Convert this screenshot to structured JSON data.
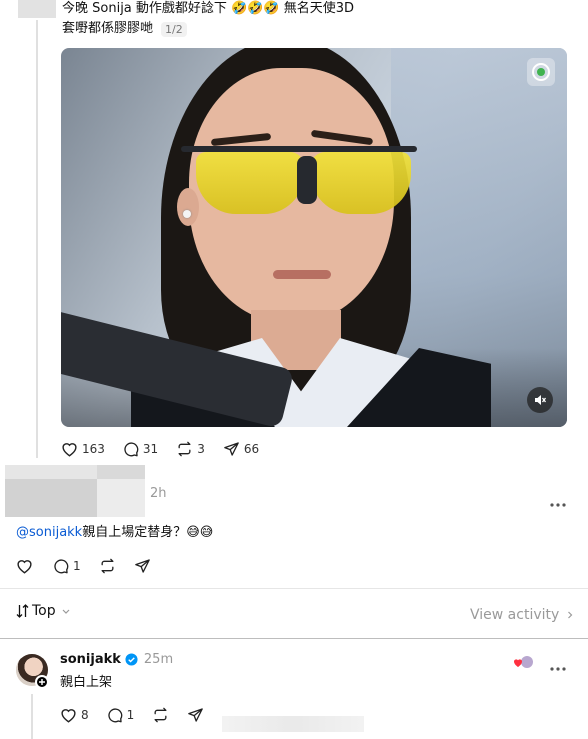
{
  "post1": {
    "text_line1": "今晚 Sonija 動作戲都好諗下 🤣🤣🤣 無名天使3D",
    "text_line2": "套嘢都係膠膠哋",
    "media_counter": "1/2",
    "likes": "163",
    "comments": "31",
    "reposts": "3",
    "shares": "66"
  },
  "reply1": {
    "time": "2h",
    "mention": "@sonijakk",
    "text": "親自上場定替身？😅😅",
    "comments": "1"
  },
  "sort_bar": {
    "sort_label": "Top",
    "view_activity": "View activity"
  },
  "reply2": {
    "username": "sonijakk",
    "time": "25m",
    "text": "親白上架",
    "likes": "8",
    "comments": "1"
  },
  "colors": {
    "verified_blue": "#0095f6",
    "link_blue": "#0a5bd3",
    "heart_red": "#ff3040"
  }
}
